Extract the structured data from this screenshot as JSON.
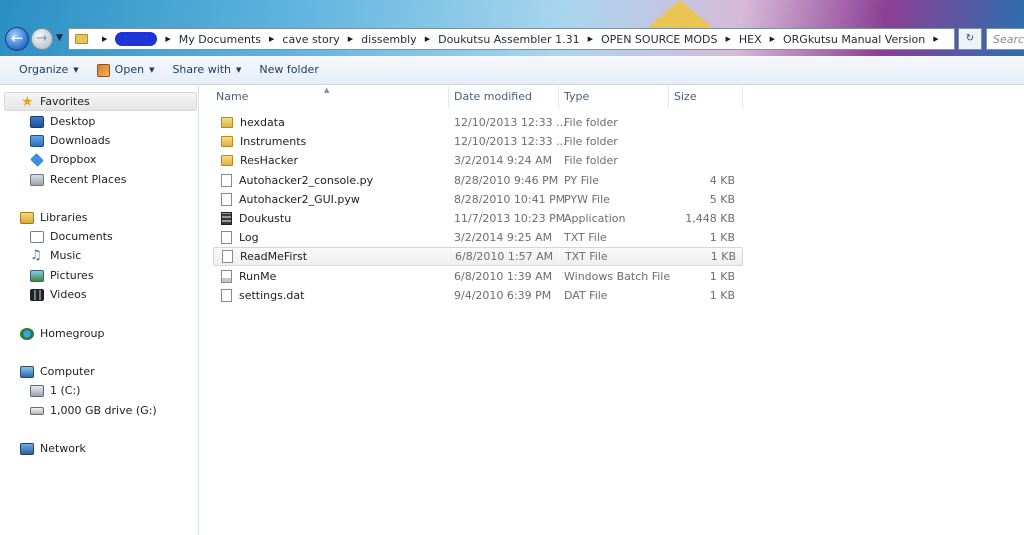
{
  "addressbar": {
    "crumbs": [
      "My Documents",
      "cave story",
      "dissembly",
      "Doukutsu Assembler 1.31",
      "OPEN SOURCE MODS",
      "HEX",
      "ORGkutsu Manual Version"
    ],
    "search_placeholder": "Search"
  },
  "toolbar": {
    "organize": "Organize",
    "open": "Open",
    "share_with": "Share with",
    "new_folder": "New folder"
  },
  "nav": {
    "favorites": "Favorites",
    "desktop": "Desktop",
    "downloads": "Downloads",
    "dropbox": "Dropbox",
    "recent_places": "Recent Places",
    "libraries": "Libraries",
    "documents": "Documents",
    "music": "Music",
    "pictures": "Pictures",
    "videos": "Videos",
    "homegroup": "Homegroup",
    "computer": "Computer",
    "drive_c": "1 (C:)",
    "drive_g": "1,000 GB drive (G:)",
    "network": "Network"
  },
  "columns": {
    "name": "Name",
    "date_modified": "Date modified",
    "type": "Type",
    "size": "Size"
  },
  "files": [
    {
      "name": "hexdata",
      "date": "12/10/2013 12:33 ...",
      "type": "File folder",
      "size": "",
      "icon": "folder-icon"
    },
    {
      "name": "Instruments",
      "date": "12/10/2013 12:33 ...",
      "type": "File folder",
      "size": "",
      "icon": "folder-icon"
    },
    {
      "name": "ResHacker",
      "date": "3/2/2014 9:24 AM",
      "type": "File folder",
      "size": "",
      "icon": "folder-icon"
    },
    {
      "name": "Autohacker2_console.py",
      "date": "8/28/2010 9:46 PM",
      "type": "PY File",
      "size": "4 KB",
      "icon": "document-icon"
    },
    {
      "name": "Autohacker2_GUI.pyw",
      "date": "8/28/2010 10:41 PM",
      "type": "PYW File",
      "size": "5 KB",
      "icon": "document-icon"
    },
    {
      "name": "Doukustu",
      "date": "11/7/2013 10:23 PM",
      "type": "Application",
      "size": "1,448 KB",
      "icon": "application-icon"
    },
    {
      "name": "Log",
      "date": "3/2/2014 9:25 AM",
      "type": "TXT File",
      "size": "1 KB",
      "icon": "document-icon"
    },
    {
      "name": "ReadMeFirst",
      "date": "6/8/2010 1:57 AM",
      "type": "TXT File",
      "size": "1 KB",
      "icon": "document-icon"
    },
    {
      "name": "RunMe",
      "date": "6/8/2010 1:39 AM",
      "type": "Windows Batch File",
      "size": "1 KB",
      "icon": "batch-file-icon"
    },
    {
      "name": "settings.dat",
      "date": "9/4/2010 6:39 PM",
      "type": "DAT File",
      "size": "1 KB",
      "icon": "document-icon"
    }
  ]
}
